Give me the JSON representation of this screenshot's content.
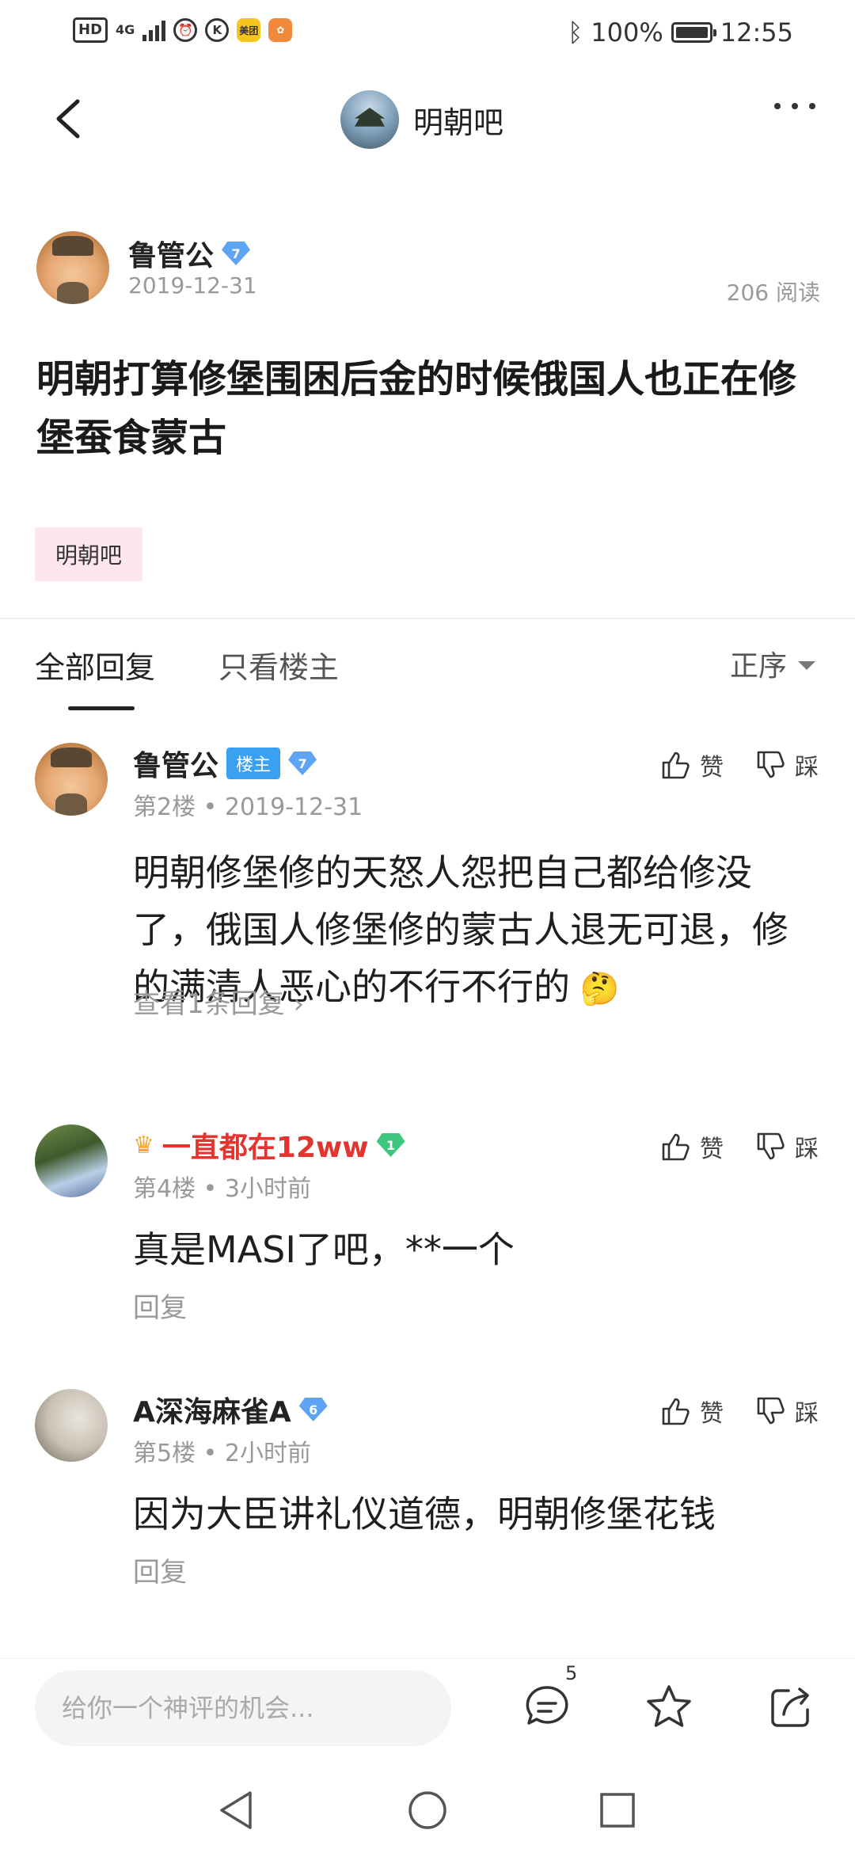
{
  "status_bar": {
    "hd": "HD",
    "network": "4G",
    "app1": "美团",
    "k_icon": "K",
    "battery": "100%",
    "time": "12:55"
  },
  "nav": {
    "title": "明朝吧"
  },
  "post": {
    "author": "鲁管公",
    "author_level": "7",
    "date": "2019-12-31",
    "read_count": "206 阅读",
    "title": "明朝打算修堡围困后金的时候俄国人也正在修堡蚕食蒙古",
    "forum_tag": "明朝吧"
  },
  "tabs": {
    "all": "全部回复",
    "owner_only": "只看楼主",
    "sort": "正序"
  },
  "actions": {
    "like": "赞",
    "dislike": "踩"
  },
  "replies": [
    {
      "name": "鲁管公",
      "badge": "楼主",
      "level": "7",
      "floor": "第2楼",
      "time": "2019-12-31",
      "text": "明朝修堡修的天怒人怨把自己都给修没了，俄国人修堡修的蒙古人退无可退，修的满清人恶心的不行不行的",
      "link": "查看1条回复 ›"
    },
    {
      "name": "一直都在12ww",
      "level": "1",
      "floor": "第4楼",
      "time": "3小时前",
      "text": "真是MASI了吧，**一个",
      "link": "回复"
    },
    {
      "name": "A深海麻雀A",
      "level": "6",
      "floor": "第5楼",
      "time": "2小时前",
      "text": "因为大臣讲礼仪道德，明朝修堡花钱",
      "link": "回复"
    }
  ],
  "bottom_bar": {
    "placeholder": "给你一个神评的机会...",
    "comment_count": "5"
  },
  "icons": {
    "back": "back-arrow-icon",
    "more": "more-icon",
    "comment": "comment-icon",
    "star": "star-icon",
    "share": "share-icon",
    "like": "thumbs-up-icon",
    "dislike": "thumbs-down-icon"
  },
  "colors": {
    "accent_blue": "#3aa0f0",
    "vip_red": "#e3342f",
    "tag_bg": "#fde6ec"
  }
}
